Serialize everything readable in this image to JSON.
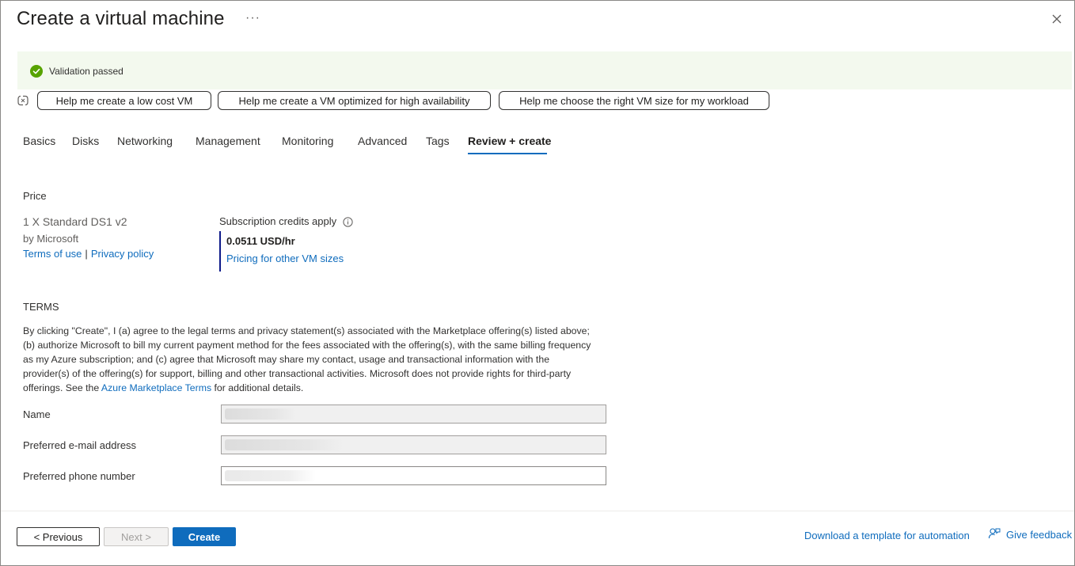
{
  "header": {
    "title": "Create a virtual machine",
    "more_label": "···"
  },
  "banner": {
    "text": "Validation passed",
    "icon": "check-circle-icon",
    "color": "#57a300"
  },
  "assist": {
    "icon": "copilot-icon",
    "pills": [
      "Help me create a low cost VM",
      "Help me create a VM optimized for high availability",
      "Help me choose the right VM size for my workload"
    ]
  },
  "tabs": [
    {
      "label": "Basics"
    },
    {
      "label": "Disks"
    },
    {
      "label": "Networking"
    },
    {
      "label": "Management"
    },
    {
      "label": "Monitoring"
    },
    {
      "label": "Advanced"
    },
    {
      "label": "Tags"
    },
    {
      "label": "Review + create",
      "active": true
    }
  ],
  "price": {
    "heading": "Price",
    "product": "1 X Standard DS1 v2",
    "publisher": "by Microsoft",
    "terms_of_use": "Terms of use",
    "separator": "|",
    "privacy_policy": "Privacy policy",
    "credits_label": "Subscription credits apply",
    "amount": "0.0511 USD/hr",
    "other_sizes_link": "Pricing for other VM sizes"
  },
  "terms": {
    "heading": "TERMS",
    "body_before_link": "By clicking \"Create\", I (a) agree to the legal terms and privacy statement(s) associated with the Marketplace offering(s) listed above; (b) authorize Microsoft to bill my current payment method for the fees associated with the offering(s), with the same billing frequency as my Azure subscription; and (c) agree that Microsoft may share my contact, usage and transactional information with the provider(s) of the offering(s) for support, billing and other transactional activities. Microsoft does not provide rights for third-party offerings. See the ",
    "link_text": "Azure Marketplace Terms",
    "body_after_link": " for additional details."
  },
  "contact": {
    "name_label": "Name",
    "email_label": "Preferred e-mail address",
    "phone_label": "Preferred phone number"
  },
  "footer": {
    "previous": "< Previous",
    "next": "Next >",
    "create": "Create",
    "download_link": "Download a template for automation",
    "feedback_link": "Give feedback"
  },
  "colors": {
    "accent": "#0f6cbd",
    "banner_bg": "#f3f9ee",
    "success": "#57a300"
  }
}
